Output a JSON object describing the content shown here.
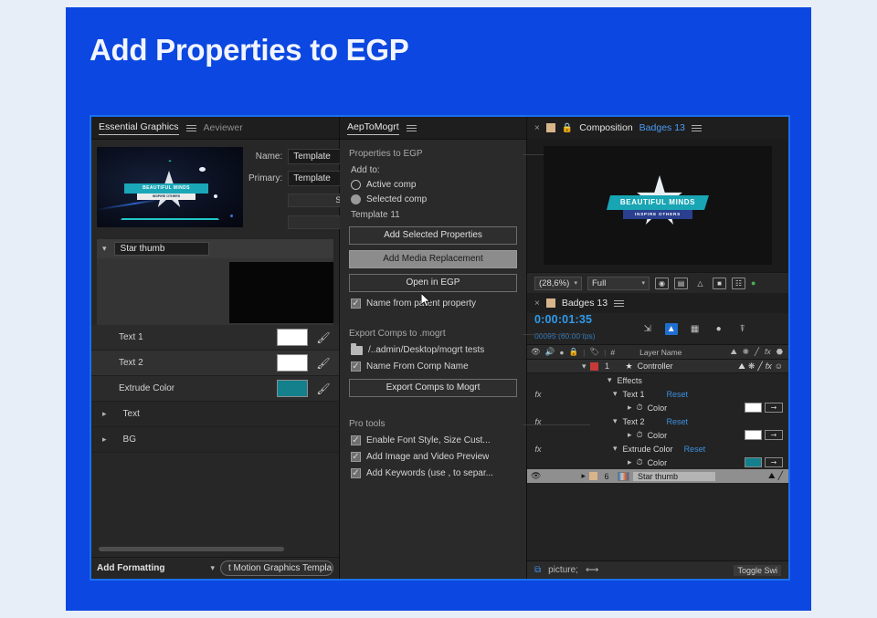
{
  "slide": {
    "title": "Add Properties to EGP",
    "bg": "#0b47e0"
  },
  "egp": {
    "tab_active": "Essential Graphics",
    "tab_inactive": "Aeviewer",
    "name_label": "Name:",
    "name_value": "Template",
    "primary_label": "Primary:",
    "primary_value": "Template",
    "blank_field_1": "S",
    "blank_field_2": "",
    "media_row_name": "Star thumb",
    "properties": [
      {
        "label": "Text 1",
        "swatch": "#ffffff",
        "eyedropper": "eyedropper-icon"
      },
      {
        "label": "Text 2",
        "swatch": "#ffffff",
        "eyedropper": "eyedropper-icon"
      },
      {
        "label": "Extrude Color",
        "swatch": "#13808c",
        "eyedropper": "eyedropper-icon"
      }
    ],
    "groups": [
      {
        "label": "Text"
      },
      {
        "label": "BG"
      }
    ],
    "bottom_left": "Add Formatting",
    "bottom_button": "t Motion Graphics Template..."
  },
  "mogrt": {
    "tab": "AepToMogrt",
    "section_properties": "Properties to EGP",
    "add_to_label": "Add to:",
    "radio_active": "Active comp",
    "radio_selected": "Selected comp",
    "template_label": "Template 11",
    "btn_add_selected": "Add Selected Properties",
    "btn_add_media": "Add Media Replacement",
    "btn_open_egp": "Open in EGP",
    "chk_name_parent": "Name from parent property",
    "section_export": "Export Comps to .mogrt",
    "export_path": "/..admin/Desktop/mogrt tests",
    "chk_name_from_comp": "Name From Comp Name",
    "btn_export": "Export Comps to Mogrt",
    "section_pro": "Pro tools",
    "pro_items": [
      "Enable Font Style, Size Cust...",
      "Add Image and Video Preview",
      "Add Keywords (use , to separ..."
    ]
  },
  "comp": {
    "close": "×",
    "title": "Composition",
    "name": "Badges 13",
    "logo_line1": "BEAUTIFUL MINDS",
    "logo_line2": "INSPIRE OTHERS",
    "zoom": "(28,6%)",
    "resolution": "Full",
    "toolbar_icons": [
      "transparency-grid-icon",
      "mask-icon",
      "region-of-interest-icon",
      "title-safe-icon",
      "grid-icon"
    ]
  },
  "timeline": {
    "tab": "Badges 13",
    "timecode": "0:00:01:35",
    "frames": "00095 (60.00 fps)",
    "columns": {
      "layer_name": "Layer Name",
      "hash": "#"
    },
    "rows": [
      {
        "kind": "layer",
        "index": "1",
        "name": "Controller",
        "label_color": "#c43b36"
      },
      {
        "kind": "group",
        "name": "Effects"
      },
      {
        "kind": "effect",
        "name": "Text 1",
        "reset": "Reset"
      },
      {
        "kind": "prop",
        "name": "Color",
        "swatch": "#ffffff"
      },
      {
        "kind": "effect",
        "name": "Text 2",
        "reset": "Reset"
      },
      {
        "kind": "prop",
        "name": "Color",
        "swatch": "#ffffff"
      },
      {
        "kind": "effect",
        "name": "Extrude Color",
        "reset": "Reset"
      },
      {
        "kind": "prop",
        "name": "Color",
        "swatch": "#13808c"
      },
      {
        "kind": "layer-selected",
        "index": "6",
        "name": "Star thumb",
        "label_color": "#d8b48a"
      }
    ],
    "toggle_switches": "Toggle Swi"
  }
}
